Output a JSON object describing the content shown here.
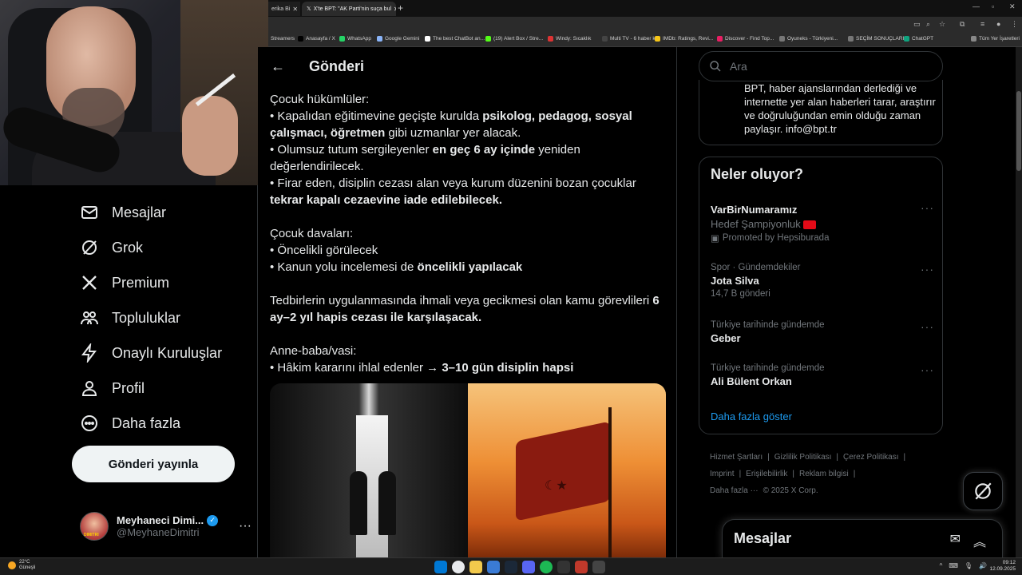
{
  "browser": {
    "tabs": [
      {
        "label": "erika Bi"
      },
      {
        "label": "X'te BPT: \"AK Parti'nin suça bul"
      }
    ],
    "bookmarks": [
      {
        "label": "Streamers",
        "color": "#555"
      },
      {
        "label": "Anasayfa / X",
        "color": "#000"
      },
      {
        "label": "WhatsApp",
        "color": "#25d366"
      },
      {
        "label": "Google Gemini",
        "color": "#8ab4f8"
      },
      {
        "label": "The best ChatBot an...",
        "color": "#fff"
      },
      {
        "label": "(19) Alert Box / Stre...",
        "color": "#53fc18"
      },
      {
        "label": "Windy: Sıcaklık",
        "color": "#d33"
      },
      {
        "label": "Multi TV - 6 haber k...",
        "color": "#444"
      },
      {
        "label": "IMDb: Ratings, Revi...",
        "color": "#f5c518"
      },
      {
        "label": "Discover - Find Top...",
        "color": "#e91e63"
      },
      {
        "label": "Oyuneks - Türkiyeni...",
        "color": "#777"
      },
      {
        "label": "SEÇİM SONUÇLARI...",
        "color": "#777"
      },
      {
        "label": "ChatGPT",
        "color": "#10a37f"
      },
      {
        "label": "Tüm Yer İşaretleri",
        "color": "#888"
      }
    ]
  },
  "leftnav": {
    "items": [
      {
        "label": "Mesajlar",
        "icon": "envelope-icon"
      },
      {
        "label": "Grok",
        "icon": "grok-icon"
      },
      {
        "label": "Premium",
        "icon": "x-logo-icon"
      },
      {
        "label": "Topluluklar",
        "icon": "people-icon"
      },
      {
        "label": "Onaylı Kuruluşlar",
        "icon": "lightning-icon"
      },
      {
        "label": "Profil",
        "icon": "person-icon"
      },
      {
        "label": "Daha fazla",
        "icon": "more-circle-icon"
      }
    ],
    "post_button": "Gönderi yayınla",
    "profile": {
      "name": "Meyhaneci Dimi...",
      "handle": "@MeyhaneDimitri",
      "avatar_text": "DIMITRI"
    }
  },
  "main": {
    "title": "Gönderi",
    "post_lines": [
      [
        {
          "t": "Çocuk hükümlüler:",
          "b": false
        }
      ],
      [
        {
          "t": "• Kapalıdan eğitimevine geçişte kurulda ",
          "b": false
        },
        {
          "t": "psikolog, pedagog, sosyal",
          "b": true
        }
      ],
      [
        {
          "t": "çalışmacı, öğretmen",
          "b": true
        },
        {
          "t": " gibi uzmanlar yer alacak.",
          "b": false
        }
      ],
      [
        {
          "t": "• Olumsuz tutum sergileyenler ",
          "b": false
        },
        {
          "t": "en geç 6 ay içinde",
          "b": true
        },
        {
          "t": " yeniden",
          "b": false
        }
      ],
      [
        {
          "t": "değerlendirilecek.",
          "b": false
        }
      ],
      [
        {
          "t": "• Firar eden, disiplin cezası alan veya kurum düzenini bozan çocuklar",
          "b": false
        }
      ],
      [
        {
          "t": "tekrar kapalı cezaevine iade edilebilecek.",
          "b": true
        }
      ],
      [],
      [
        {
          "t": "Çocuk davaları:",
          "b": false
        }
      ],
      [
        {
          "t": "• Öncelikli görülecek",
          "b": false
        }
      ],
      [
        {
          "t": "• Kanun yolu incelemesi de ",
          "b": false
        },
        {
          "t": "öncelikli yapılacak",
          "b": true
        }
      ],
      [],
      [
        {
          "t": "Tedbirlerin uygulanmasında ihmali veya gecikmesi olan kamu görevlileri ",
          "b": false
        },
        {
          "t": "6",
          "b": true
        }
      ],
      [
        {
          "t": "ay–2 yıl hapis cezası ile karşılaşacak.",
          "b": true
        }
      ],
      [],
      [
        {
          "t": "Anne-baba/vasi:",
          "b": false
        }
      ],
      [
        {
          "t": "• Hâkim kararını ihlal edenler → ",
          "b": false
        },
        {
          "t": "3–10 gün disiplin hapsi",
          "b": true
        }
      ]
    ]
  },
  "right": {
    "search_placeholder": "Ara",
    "bio": "BPT, haber ajanslarından derlediği ve internette yer alan haberleri tarar, araştırır ve doğruluğundan emin olduğu zaman paylaşır. info@bpt.tr",
    "trends_title": "Neler oluyor?",
    "trends": [
      {
        "category": "",
        "name": "VarBirNumaramız",
        "sub": "Hedef Şampiyonluk",
        "promo": "Promoted by Hepsiburada",
        "count": ""
      },
      {
        "category": "Spor · Gündemdekiler",
        "name": "Jota Silva",
        "sub": "",
        "promo": "",
        "count": "14,7 B gönderi"
      },
      {
        "category": "Türkiye tarihinde gündemde",
        "name": "Geber",
        "sub": "",
        "promo": "",
        "count": ""
      },
      {
        "category": "Türkiye tarihinde gündemde",
        "name": "Ali Bülent Orkan",
        "sub": "",
        "promo": "",
        "count": ""
      }
    ],
    "show_more": "Daha fazla göster",
    "footer": [
      "Hizmet Şartları",
      "|",
      "Gizlilik Politikası",
      "|",
      "Çerez Politikası",
      "|",
      "Imprint",
      "|",
      "Erişilebilirlik",
      "|",
      "Reklam bilgisi",
      "|",
      "Daha fazla ···",
      "© 2025 X Corp."
    ],
    "messages_title": "Mesajlar"
  },
  "taskbar": {
    "temp": "22°C",
    "weather": "Güneşli",
    "time": "09:12",
    "date": "12.09.2025"
  }
}
